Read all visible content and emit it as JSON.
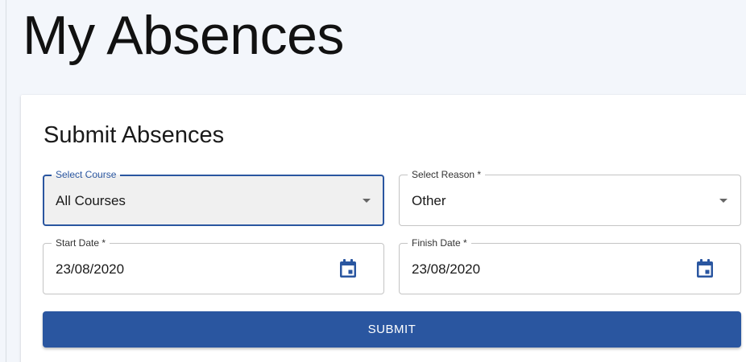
{
  "page": {
    "title": "My Absences"
  },
  "form": {
    "title": "Submit Absences",
    "course": {
      "label": "Select Course",
      "value": "All Courses",
      "icon": "chevron-down-icon"
    },
    "reason": {
      "label": "Select Reason *",
      "value": "Other",
      "icon": "chevron-down-icon"
    },
    "start_date": {
      "label": "Start Date *",
      "value": "23/08/2020",
      "icon": "calendar-icon"
    },
    "finish_date": {
      "label": "Finish Date *",
      "value": "23/08/2020",
      "icon": "calendar-icon"
    },
    "submit_label": "SUBMIT"
  },
  "colors": {
    "accent": "#2a56a0",
    "page_background": "#f3f6fb",
    "card_background": "#ffffff",
    "focused_field_background": "#f0f0f0"
  }
}
